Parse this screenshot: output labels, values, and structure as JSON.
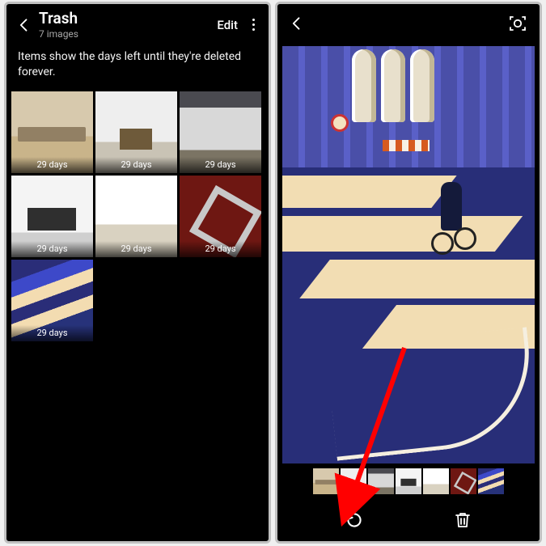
{
  "left": {
    "title": "Trash",
    "subtitle": "7 images",
    "edit_label": "Edit",
    "info_text": "Items show the days left until they're deleted forever.",
    "thumbnails": [
      {
        "days_left": "29 days"
      },
      {
        "days_left": "29 days"
      },
      {
        "days_left": "29 days"
      },
      {
        "days_left": "29 days"
      },
      {
        "days_left": "29 days"
      },
      {
        "days_left": "29 days"
      },
      {
        "days_left": "29 days"
      }
    ]
  },
  "right": {
    "filmstrip_count": 7,
    "selected_index": 6,
    "actions": {
      "restore": "Restore",
      "delete": "Delete"
    }
  },
  "annotation": {
    "arrow_target": "restore-button",
    "arrow_color": "#ff0000"
  }
}
